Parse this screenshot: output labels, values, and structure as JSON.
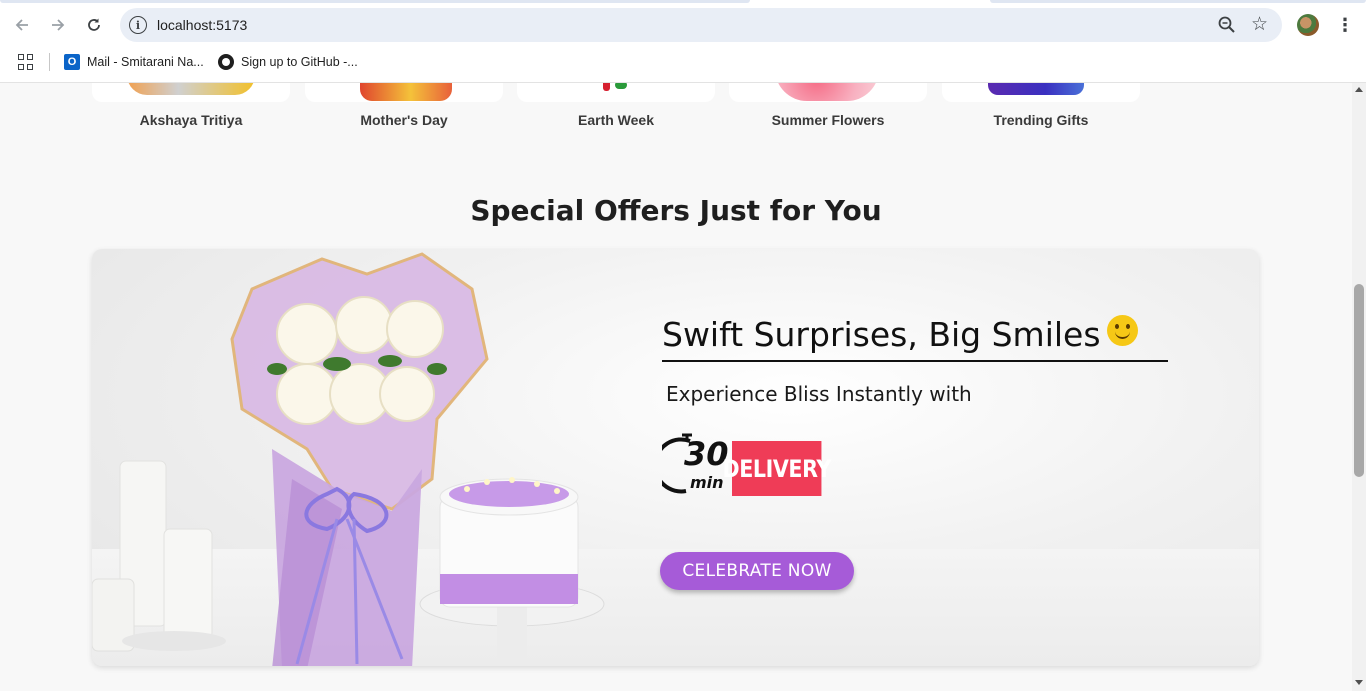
{
  "browser": {
    "url": "localhost:5173",
    "bookmarks": [
      {
        "label": "Mail - Smitarani Na...",
        "icon": "outlook-icon"
      },
      {
        "label": "Sign up to GitHub -...",
        "icon": "github-icon"
      }
    ]
  },
  "occasions": [
    {
      "label": "Akshaya Tritiya"
    },
    {
      "label": "Mother's Day"
    },
    {
      "label": "Earth Week"
    },
    {
      "label": "Summer Flowers"
    },
    {
      "label": "Trending Gifts"
    }
  ],
  "special_offers": {
    "title": "Special Offers Just for You",
    "banner": {
      "headline": "Swift Surprises, Big Smiles",
      "subheadline": "Experience Bliss Instantly with",
      "delivery_number": "30",
      "delivery_unit": "min",
      "delivery_label": "DELIVERY",
      "cta_label": "CELEBRATE NOW"
    }
  },
  "colors": {
    "cta": "#a65bd8",
    "delivery_badge": "#ef3c57",
    "page_bg": "#f8f8f8"
  }
}
